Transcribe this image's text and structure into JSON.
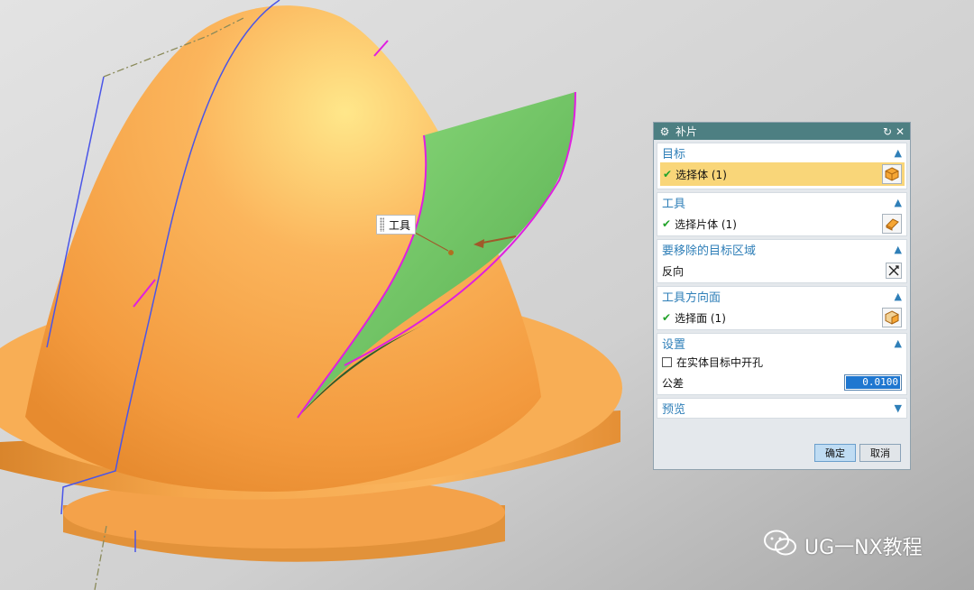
{
  "graphics": {
    "tool_tag": "工具"
  },
  "dialog": {
    "title": "补片",
    "groups": {
      "target": {
        "header": "目标",
        "row_label": "选择体 (1)"
      },
      "tool": {
        "header": "工具",
        "row_label": "选择片体 (1)"
      },
      "remove_region": {
        "header": "要移除的目标区域",
        "row_label": "反向"
      },
      "tool_face": {
        "header": "工具方向面",
        "row_label": "选择面 (1)"
      },
      "settings": {
        "header": "设置",
        "checkbox_label": "在实体目标中开孔",
        "checkbox_checked": false,
        "tolerance_label": "公差",
        "tolerance_value": "0.0100"
      },
      "preview": {
        "header": "预览"
      }
    },
    "buttons": {
      "ok": "确定",
      "cancel": "取消"
    }
  },
  "watermark": {
    "text": "UG一NX教程"
  },
  "colors": {
    "titlebar": "#4d7f82",
    "header_text": "#2f7fb8",
    "selected_row": "#f9d679",
    "body_orange": "#f7a84a",
    "sheet_green": "#7ad06a",
    "edge_magenta": "#e01ee0"
  }
}
